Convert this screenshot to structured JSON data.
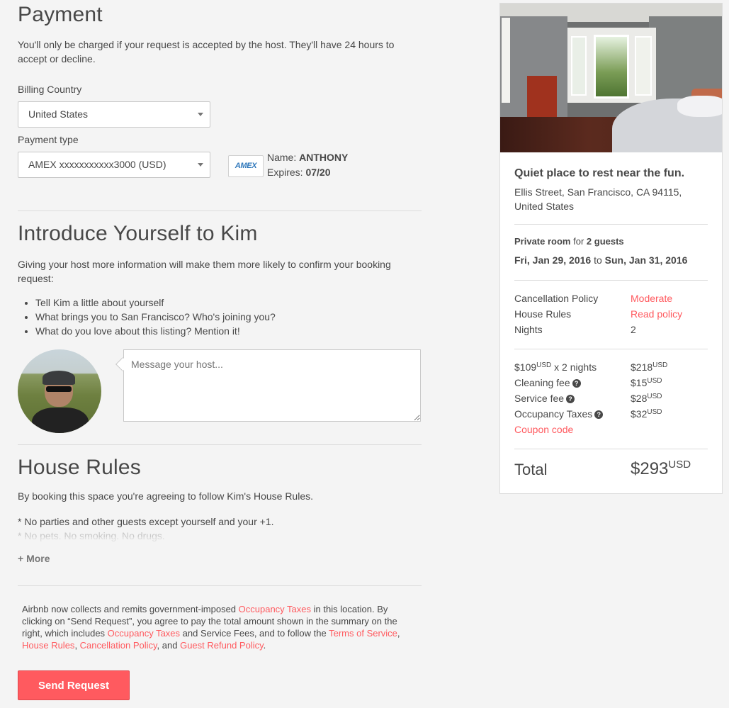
{
  "payment": {
    "title": "Payment",
    "description": "You'll only be charged if your request is accepted by the host. They'll have 24 hours to accept or decline.",
    "billing_country_label": "Billing Country",
    "billing_country_value": "United States",
    "payment_type_label": "Payment type",
    "payment_type_value": "AMEX xxxxxxxxxxx3000 (USD)",
    "card_logo": "AMEX",
    "name_label": "Name:",
    "name_value": "ANTHONY",
    "expires_label": "Expires:",
    "expires_value": "07/20"
  },
  "introduce": {
    "title": "Introduce Yourself to Kim",
    "description": "Giving your host more information will make them more likely to confirm your booking request:",
    "tips": [
      "Tell Kim a little about yourself",
      "What brings you to San Francisco? Who's joining you?",
      "What do you love about this listing? Mention it!"
    ],
    "message_placeholder": "Message your host..."
  },
  "house_rules": {
    "title": "House Rules",
    "description": "By booking this space you're agreeing to follow Kim's House Rules.",
    "rule_1": "* No parties and other guests except yourself and your +1.",
    "rule_2": "* No pets. No smoking. No drugs.",
    "more_label": "+ More"
  },
  "legal": {
    "t1": "Airbnb now collects and remits government-imposed ",
    "l1": "Occupancy Taxes",
    "t2": " in this location. By clicking on “Send Request”, you agree to pay the total amount shown in the summary on the right, which includes ",
    "l2": "Occupancy Taxes",
    "t3": " and Service Fees, and to follow the ",
    "l3": "Terms of Service",
    "t4": ", ",
    "l4": "House Rules",
    "t5": ", ",
    "l5": "Cancellation Policy",
    "t6": ", and ",
    "l6": "Guest Refund Policy",
    "t7": "."
  },
  "send_button": "Send Request",
  "listing": {
    "title": "Quiet place to rest near the fun.",
    "address": "Ellis Street, San Francisco, CA 94115, United States",
    "room_type": "Private room",
    "for_text": "for",
    "guests": "2 guests",
    "check_in": "Fri, Jan 29, 2016",
    "to_text": "to",
    "check_out": "Sun, Jan 31, 2016",
    "cancellation_label": "Cancellation Policy",
    "cancellation_value": "Moderate",
    "house_rules_label": "House Rules",
    "house_rules_value": "Read policy",
    "nights_label": "Nights",
    "nights_value": "2",
    "nightly_price": "$109",
    "currency": "USD",
    "nights_multiplier": "x 2 nights",
    "subtotal": "$218",
    "cleaning_label": "Cleaning fee",
    "cleaning_value": "$15",
    "service_label": "Service fee",
    "service_value": "$28",
    "occupancy_label": "Occupancy Taxes",
    "occupancy_value": "$32",
    "help_glyph": "?",
    "coupon_label": "Coupon code",
    "total_label": "Total",
    "total_value": "$293"
  },
  "colors": {
    "accent": "#ff5a5f",
    "text": "#484848",
    "background": "#f4f4f4"
  }
}
